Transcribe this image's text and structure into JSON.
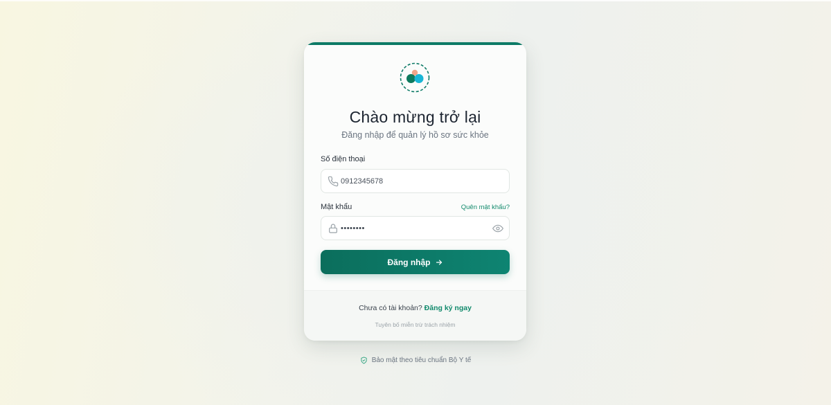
{
  "card": {
    "title": "Chào mừng trở lại",
    "subtitle": "Đăng nhập để quản lý hồ sơ sức khỏe"
  },
  "form": {
    "phone": {
      "label": "Số điện thoại",
      "value": "0912345678",
      "icon": "phone-icon"
    },
    "password": {
      "label": "Mật khẩu",
      "value": "••••••••",
      "forgot_label": "Quên mật khẩu?",
      "icon": "lock-icon",
      "toggle_icon": "eye-icon"
    },
    "submit_label": "Đăng nhập"
  },
  "footer": {
    "signup_prompt": "Chưa có tài khoản?",
    "signup_link": "Đăng ký ngay",
    "disclaimer": "Tuyên bố miễn trừ trách nhiệm"
  },
  "security_note": "Bảo mật theo tiêu chuẩn Bộ Y tế",
  "colors": {
    "brand": "#0d7a66",
    "accent_link": "#128a6c",
    "logo_orange": "#f2a58a",
    "logo_teal": "#0e7a5e",
    "logo_cyan": "#1ab6d6"
  }
}
